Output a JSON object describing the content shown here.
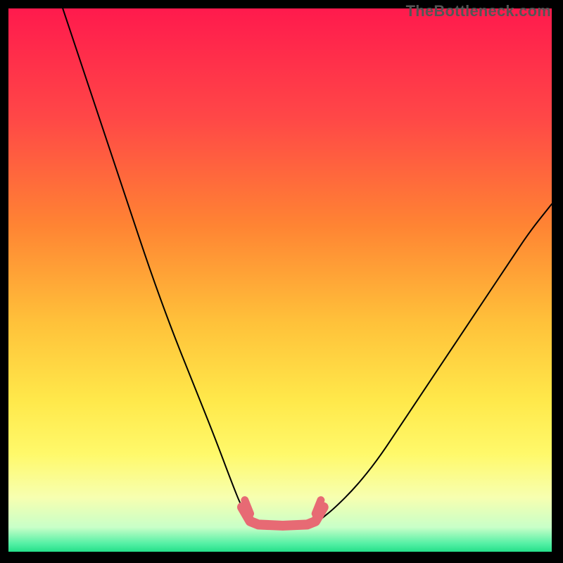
{
  "watermark": "TheBottleneck.com",
  "chart_data": {
    "type": "line",
    "title": "",
    "xlabel": "",
    "ylabel": "",
    "xlim": [
      0,
      100
    ],
    "ylim": [
      0,
      100
    ],
    "series": [
      {
        "name": "left-curve",
        "x": [
          10,
          14,
          18,
          22,
          26,
          30,
          34,
          38,
          41,
          43,
          44.5
        ],
        "y": [
          100,
          88,
          76,
          64,
          52,
          41,
          31,
          21,
          13,
          8,
          6
        ]
      },
      {
        "name": "valley-floor",
        "x": [
          44.5,
          46,
          48,
          50,
          52,
          54,
          56,
          57.5
        ],
        "y": [
          6,
          5.2,
          5,
          5,
          5,
          5.2,
          5.5,
          6
        ]
      },
      {
        "name": "right-curve",
        "x": [
          57.5,
          60,
          64,
          68,
          72,
          76,
          80,
          84,
          88,
          92,
          96,
          100
        ],
        "y": [
          6,
          8,
          12,
          17,
          23,
          29,
          35,
          41,
          47,
          53,
          59,
          64
        ]
      }
    ],
    "highlight_band": {
      "name": "green-band",
      "y_range": [
        0,
        5
      ],
      "color": "#25e08a"
    },
    "valley_highlight": {
      "name": "pink-valley-marker",
      "x_range": [
        43,
        58
      ],
      "y": 5,
      "color": "#e76a74"
    },
    "background_gradient": {
      "stops": [
        {
          "pos": 0.0,
          "color": "#ff1a4d"
        },
        {
          "pos": 0.2,
          "color": "#ff4747"
        },
        {
          "pos": 0.4,
          "color": "#ff8433"
        },
        {
          "pos": 0.58,
          "color": "#ffc23a"
        },
        {
          "pos": 0.72,
          "color": "#ffe84a"
        },
        {
          "pos": 0.82,
          "color": "#fff96a"
        },
        {
          "pos": 0.9,
          "color": "#f7ffb0"
        },
        {
          "pos": 0.955,
          "color": "#c8ffc8"
        },
        {
          "pos": 0.985,
          "color": "#54f0a5"
        },
        {
          "pos": 1.0,
          "color": "#25e08a"
        }
      ]
    }
  }
}
